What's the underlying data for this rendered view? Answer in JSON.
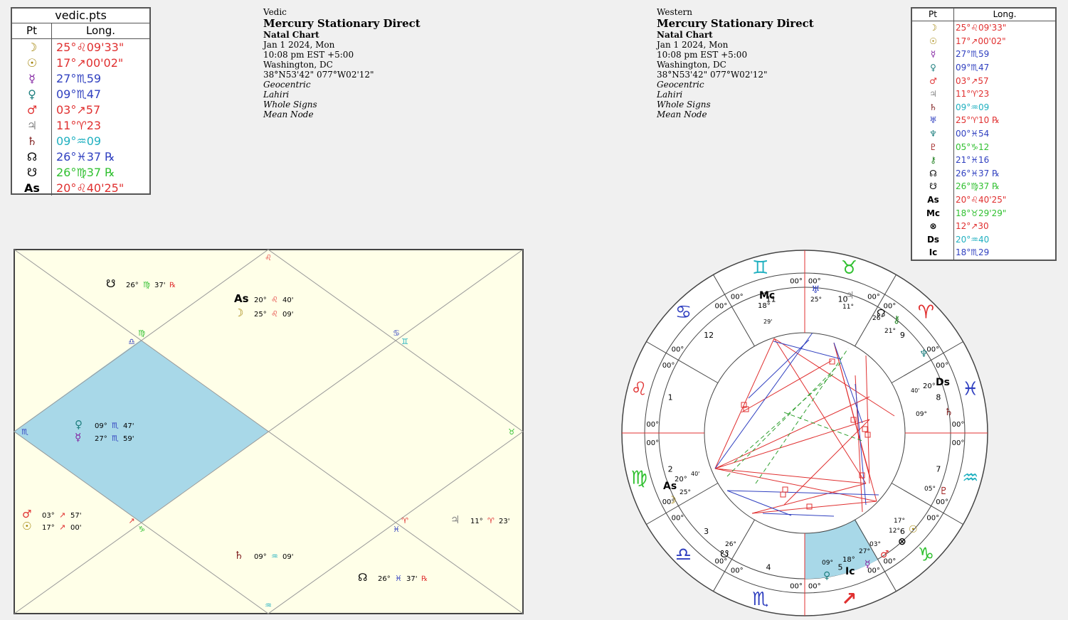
{
  "vedic_table": {
    "title": "vedic.pts",
    "col_pt": "Pt",
    "col_long": "Long.",
    "rows": [
      {
        "glyph": "☽",
        "value": "25°♌09'33\"",
        "color": "#e03030",
        "gcolor": "#a08000"
      },
      {
        "glyph": "☉",
        "value": "17°↗00'02\"",
        "color": "#e03030",
        "gcolor": "#a08000"
      },
      {
        "glyph": "☿",
        "value": "27°♏59",
        "color": "#3040c0",
        "gcolor": "#8020a0"
      },
      {
        "glyph": "♀",
        "value": "09°♏47",
        "color": "#3040c0",
        "gcolor": "#208080"
      },
      {
        "glyph": "♂",
        "value": "03°↗57",
        "color": "#e03030",
        "gcolor": "#e03030"
      },
      {
        "glyph": "♃",
        "value": "11°♈23",
        "color": "#e03030",
        "gcolor": "#888888"
      },
      {
        "glyph": "♄",
        "value": "09°♒09",
        "color": "#20b0c0",
        "gcolor": "#802020"
      },
      {
        "glyph": "☊",
        "value": "26°♓37 ℞",
        "color": "#3040c0",
        "gcolor": "#000000"
      },
      {
        "glyph": "☋",
        "value": "26°♍37 ℞",
        "color": "#30c030",
        "gcolor": "#000000"
      },
      {
        "glyph": "As",
        "value": "20°♌40'25\"",
        "color": "#e03030",
        "gcolor": "#000000"
      }
    ]
  },
  "western_table": {
    "col_pt": "Pt",
    "col_long": "Long.",
    "rows": [
      {
        "glyph": "☽",
        "value": "25°♌09'33\"",
        "color": "#e03030",
        "gcolor": "#a08000"
      },
      {
        "glyph": "☉",
        "value": "17°↗00'02\"",
        "color": "#e03030",
        "gcolor": "#a08000"
      },
      {
        "glyph": "☿",
        "value": "27°♏59",
        "color": "#3040c0",
        "gcolor": "#8020a0"
      },
      {
        "glyph": "♀",
        "value": "09°♏47",
        "color": "#3040c0",
        "gcolor": "#208080"
      },
      {
        "glyph": "♂",
        "value": "03°↗57",
        "color": "#e03030",
        "gcolor": "#e03030"
      },
      {
        "glyph": "♃",
        "value": "11°♈23",
        "color": "#e03030",
        "gcolor": "#888888"
      },
      {
        "glyph": "♄",
        "value": "09°♒09",
        "color": "#20b0c0",
        "gcolor": "#802020"
      },
      {
        "glyph": "♅",
        "value": "25°♈10 ℞",
        "color": "#e03030",
        "gcolor": "#3040c0"
      },
      {
        "glyph": "♆",
        "value": "00°♓54",
        "color": "#3040c0",
        "gcolor": "#208080"
      },
      {
        "glyph": "♇",
        "value": "05°♑12",
        "color": "#30c030",
        "gcolor": "#a02020"
      },
      {
        "glyph": "⚷",
        "value": "21°♓16",
        "color": "#3040c0",
        "gcolor": "#208020"
      },
      {
        "glyph": "☊",
        "value": "26°♓37 ℞",
        "color": "#3040c0",
        "gcolor": "#000000"
      },
      {
        "glyph": "☋",
        "value": "26°♍37 ℞",
        "color": "#30c030",
        "gcolor": "#000000"
      },
      {
        "glyph": "As",
        "value": "20°♌40'25\"",
        "color": "#e03030",
        "gcolor": "#000000"
      },
      {
        "glyph": "Mc",
        "value": "18°♉29'29\"",
        "color": "#30c030",
        "gcolor": "#000000"
      },
      {
        "glyph": "⊗",
        "value": "12°↗30",
        "color": "#e03030",
        "gcolor": "#000000"
      },
      {
        "glyph": "Ds",
        "value": "20°♒40",
        "color": "#20b0c0",
        "gcolor": "#000000"
      },
      {
        "glyph": "Ic",
        "value": "18°♏29",
        "color": "#3040c0",
        "gcolor": "#000000"
      }
    ]
  },
  "vedic_info": {
    "label": "Vedic",
    "title": "Mercury Stationary Direct",
    "chart_type": "Natal Chart",
    "date": "Jan 1 2024, Mon",
    "time": "10:08 pm  EST +5:00",
    "place": "Washington, DC",
    "coords": "38°N53'42\"  077°W02'12\"",
    "system1": "Geocentric",
    "system2": "Lahiri",
    "system3": "Whole Signs",
    "system4": "Mean Node"
  },
  "western_info": {
    "label": "Western",
    "title": "Mercury Stationary Direct",
    "chart_type": "Natal Chart",
    "date": "Jan 1 2024, Mon",
    "time": "10:08 pm  EST +5:00",
    "place": "Washington, DC",
    "coords": "38°N53'42\"  077°W02'12\"",
    "system1": "Geocentric",
    "system2": "Lahiri",
    "system3": "Whole Signs",
    "system4": "Mean Node"
  },
  "vedic_chart": {
    "signs": {
      "top": "♌",
      "upper_left": "♍",
      "upper_left_b": "♎",
      "upper_right": "♋",
      "upper_right_b": "♊",
      "left": "♏",
      "right": "♉",
      "lower_left": "↗",
      "lower_left_b": "♑",
      "lower_right": "♈",
      "lower_right_b": "♓",
      "bottom": "♒"
    },
    "placements": [
      {
        "glyph": "☋",
        "deg": "26°",
        "sign": "♍",
        "min": "37'",
        "rx": "℞",
        "sign_color": "#30c030"
      },
      {
        "glyph": "As",
        "deg": "20°",
        "sign": "♌",
        "min": "40'",
        "rx": "",
        "sign_color": "#e03030"
      },
      {
        "glyph": "☽",
        "deg": "25°",
        "sign": "♌",
        "min": "09'",
        "rx": "",
        "sign_color": "#e03030"
      },
      {
        "glyph": "♀",
        "deg": "09°",
        "sign": "♏",
        "min": "47'",
        "rx": "",
        "sign_color": "#3040c0"
      },
      {
        "glyph": "☿",
        "deg": "27°",
        "sign": "♏",
        "min": "59'",
        "rx": "",
        "sign_color": "#3040c0"
      },
      {
        "glyph": "♂",
        "deg": "03°",
        "sign": "↗",
        "min": "57'",
        "rx": "",
        "sign_color": "#e03030"
      },
      {
        "glyph": "☉",
        "deg": "17°",
        "sign": "↗",
        "min": "00'",
        "rx": "",
        "sign_color": "#e03030"
      },
      {
        "glyph": "♃",
        "deg": "11°",
        "sign": "♈",
        "min": "23'",
        "rx": "",
        "sign_color": "#e03030"
      },
      {
        "glyph": "♄",
        "deg": "09°",
        "sign": "♒",
        "min": "09'",
        "rx": "",
        "sign_color": "#20b0c0"
      },
      {
        "glyph": "☊",
        "deg": "26°",
        "sign": "♓",
        "min": "37'",
        "rx": "℞",
        "sign_color": "#3040c0"
      }
    ]
  },
  "wheel": {
    "house_numbers": [
      "1",
      "2",
      "3",
      "4",
      "5",
      "6",
      "7",
      "8",
      "9",
      "10",
      "11",
      "12"
    ],
    "cusp_label": "00°",
    "angles": {
      "mc": "Mc",
      "ic": "Ic",
      "as": "As",
      "ds": "Ds"
    },
    "mc_deg": "18°",
    "mc_min": "29'",
    "ic_deg": "18°",
    "ic_min": "29'",
    "as_deg": "20°",
    "as_min": "40'",
    "ds_deg": "20°",
    "ds_min": "40'"
  }
}
